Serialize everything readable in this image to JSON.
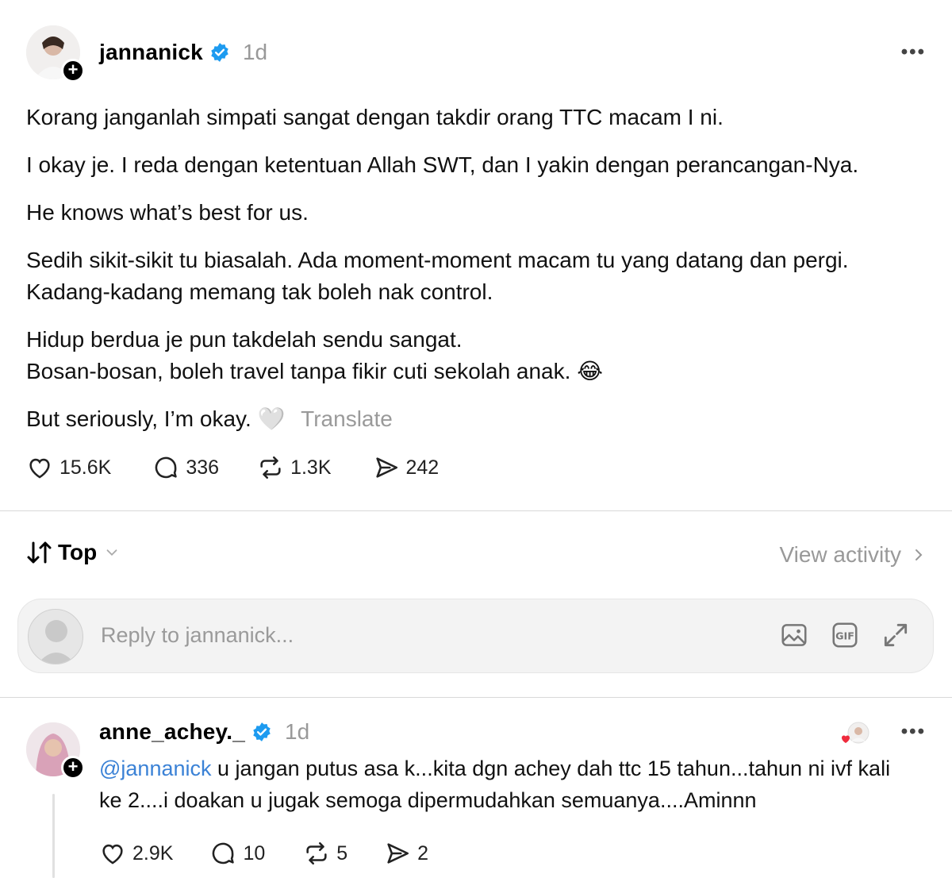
{
  "post": {
    "username": "jannanick",
    "timestamp": "1d",
    "paragraphs": [
      "Korang janganlah simpati sangat dengan takdir orang TTC macam I ni.",
      "I okay je. I reda dengan ketentuan Allah SWT, dan I yakin dengan perancangan-Nya.",
      "He knows what’s best for us.",
      "Sedih sikit-sikit tu biasalah. Ada moment-moment macam tu yang datang dan pergi. Kadang-kadang memang tak boleh nak control.",
      "Hidup berdua je pun takdelah sendu sangat.",
      "Bosan-bosan, boleh travel tanpa fikir cuti sekolah anak. 😂",
      "But seriously, I’m okay. 🤍"
    ],
    "translate_label": "Translate",
    "likes": "15.6K",
    "comments": "336",
    "reposts": "1.3K",
    "shares": "242"
  },
  "sort": {
    "label": "Top",
    "view_activity": "View activity"
  },
  "reply": {
    "placeholder": "Reply to jannanick..."
  },
  "comment": {
    "username": "anne_achey._",
    "timestamp": "1d",
    "mention": "@jannanick",
    "text": " u jangan putus asa k...kita dgn achey dah ttc 15 tahun...tahun ni ivf kali ke 2....i doakan u jugak semoga dipermudahkan semuanya....Aminnn",
    "likes": "2.9K",
    "comments": "10",
    "reposts": "5",
    "shares": "2"
  },
  "colors": {
    "verified": "#1d9bf0",
    "mention": "#3b82d6",
    "muted": "#999999"
  }
}
